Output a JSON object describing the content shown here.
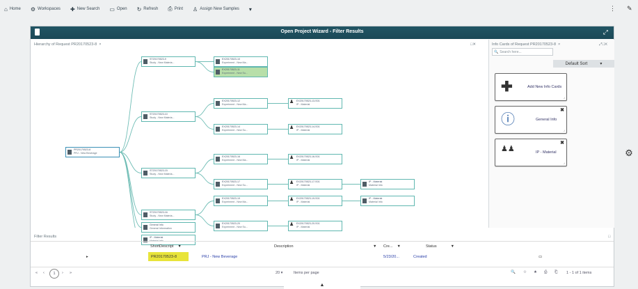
{
  "toolbar": {
    "items": [
      {
        "icon": "home-icon",
        "glyph": "⌂",
        "label": "Home"
      },
      {
        "icon": "workspaces-icon",
        "glyph": "⚙",
        "label": "Workspaces"
      },
      {
        "icon": "new-search-icon",
        "glyph": "✚",
        "label": "New Search"
      },
      {
        "icon": "open-icon",
        "glyph": "▭",
        "label": "Open"
      },
      {
        "icon": "refresh-icon",
        "glyph": "↻",
        "label": "Refresh"
      },
      {
        "icon": "print-icon",
        "glyph": "⎙",
        "label": "Print"
      },
      {
        "icon": "assign-icon",
        "glyph": "♙",
        "label": "Assign New Samples"
      },
      {
        "icon": "dropdown-icon",
        "glyph": "▾",
        "label": ""
      }
    ],
    "more_glyph": "⋮",
    "tool_glyph": "✎"
  },
  "window": {
    "title": "Open Project Wizard - Filter Results",
    "expand_glyph": "⤢"
  },
  "hierarchy": {
    "tab_label": "Hierarchy of Request PR20170523-8",
    "tab_close": "×",
    "panel_controls": "□✕",
    "nodes": {
      "root": {
        "l1": "PR20170523-8",
        "l2": "PRJ - New Beverage"
      },
      "st1": {
        "l1": "ST20170523-9",
        "l2": "Study - New Materia..."
      },
      "st2": {
        "l1": "ST20170523-10",
        "l2": "Study - New Materia..."
      },
      "st3": {
        "l1": "ST20170523-15",
        "l2": "Study - New Materia..."
      },
      "st4": {
        "l1": "ST20170523-16",
        "l2": "Study - New Materia..."
      },
      "gi": {
        "l1": "General Info",
        "l2": "General Information"
      },
      "ipm": {
        "l1": "IP - Material",
        "l2": "Material Info"
      },
      "e1": {
        "l1": "EX20170523-10",
        "l2": "Experiment - New Ma..."
      },
      "e2": {
        "l1": "EX20170523-11",
        "l2": "Experiment - New Su..."
      },
      "e3": {
        "l1": "EX20170523-12",
        "l2": "Experiment - New Ma..."
      },
      "e4": {
        "l1": "EX20170523-14",
        "l2": "Experiment - New Su..."
      },
      "e5": {
        "l1": "EX20170523-16",
        "l2": "Experiment - New Ma..."
      },
      "e6": {
        "l1": "EX20170523-17",
        "l2": "Experiment - New Su..."
      },
      "e7": {
        "l1": "EX20170523-19",
        "l2": "Experiment - New Ma..."
      },
      "e8": {
        "l1": "EX20170523-20",
        "l2": "Experiment - New Su..."
      },
      "s1": {
        "l1": "EX20170523-13-S01",
        "l2": "IP - Material"
      },
      "s2": {
        "l1": "EX20170523-14-S01",
        "l2": "IP - Material"
      },
      "s3": {
        "l1": "EX20170523-16-S01",
        "l2": "IP - Material"
      },
      "s4": {
        "l1": "EX20170523-17-S01",
        "l2": "IP - Material"
      },
      "s5": {
        "l1": "EX20170523-19-S01",
        "l2": "IP - Material"
      },
      "s6": {
        "l1": "EX20170523-20-S01",
        "l2": "IP - Material"
      },
      "m1": {
        "l1": "IP - Material",
        "l2": "Material Info"
      },
      "m2": {
        "l1": "IP - Material",
        "l2": "Material Info"
      }
    }
  },
  "info_cards": {
    "tab_label": "Info Cards of Request PR20170523-8",
    "tab_close": "×",
    "panel_controls": "⤢□✕",
    "search_placeholder": "Search here...",
    "search_glyph": "🔍",
    "sort_label": "Default Sort",
    "sort_glyph": "▾",
    "cards": [
      {
        "glyph": "✚",
        "label": "Add New Info Cards",
        "close": ""
      },
      {
        "glyph": "ⓘ",
        "label": "General Info",
        "close": "✖"
      },
      {
        "glyph": "♟♟",
        "label": "IP - Material",
        "close": "✖"
      }
    ]
  },
  "filter_results": {
    "tab_label": "Filter Results",
    "columns": [
      "ShortDescript",
      "Description",
      "Cre...",
      "Status"
    ],
    "filter_glyph": "▼",
    "row": {
      "expand": "▸",
      "short": "PR20170523-8",
      "description": "PRJ - New Beverage",
      "created": "5/23/20...",
      "status": "Created",
      "comment_glyph": "▭"
    }
  },
  "pager": {
    "first": "«",
    "prev": "‹",
    "page": "1",
    "next": "›",
    "last": "»",
    "per_page_value": "20",
    "per_page_label": "Items per page",
    "summary": "1 - 1 of 1 items",
    "icons": [
      "🔍",
      "☆",
      "★",
      "⎙",
      "⎗"
    ]
  },
  "colors": {
    "titlebar": "#1b4957",
    "node_border": "#5fb7b0",
    "selected_node": "#b8dfa9",
    "highlight_cell": "#e8e43a",
    "link": "#2a3fa8"
  }
}
